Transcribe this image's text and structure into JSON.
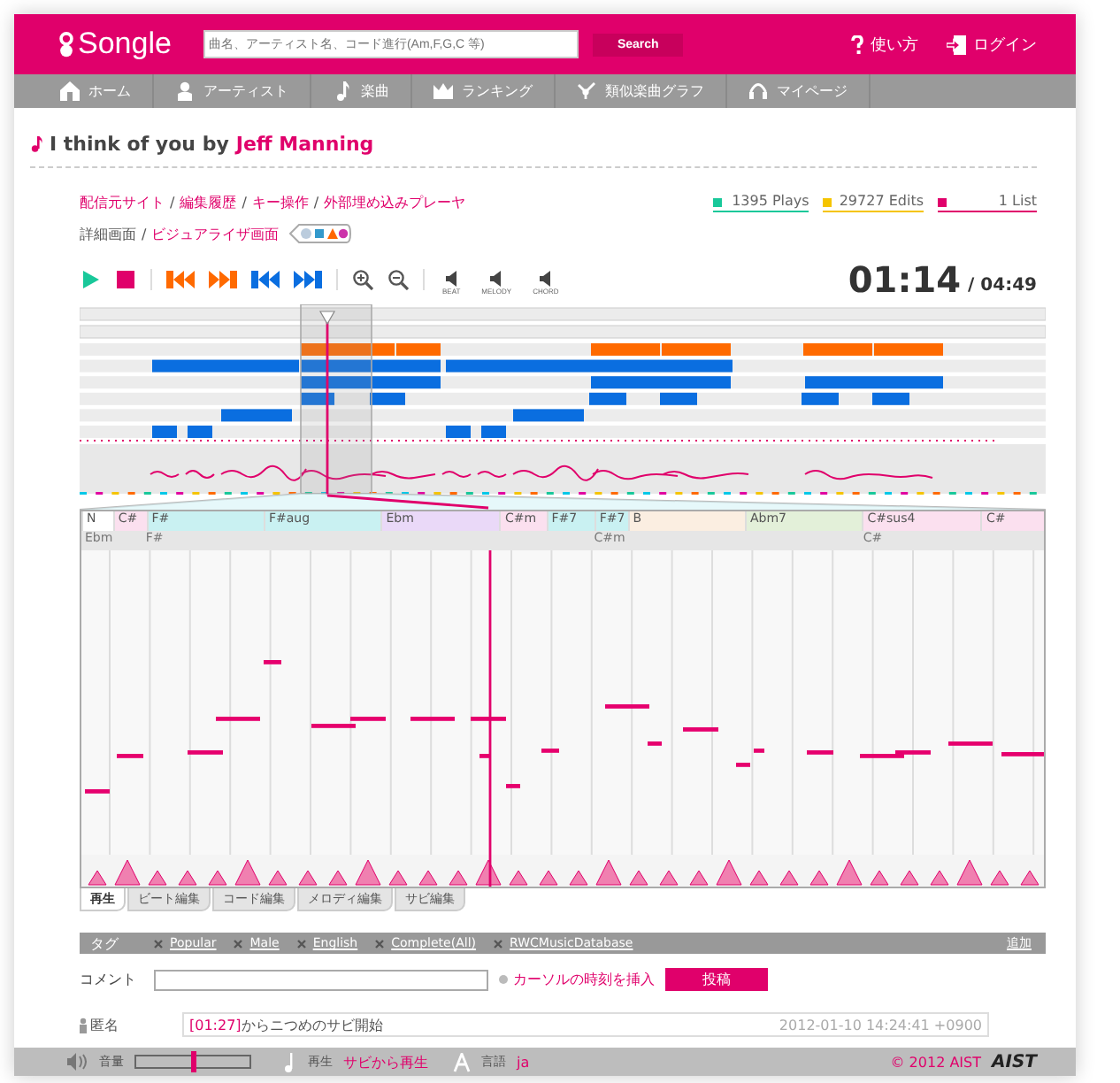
{
  "header": {
    "logo": "Songle",
    "search": {
      "placeholder": "曲名、アーティスト名、コード進行(Am,F,G,C 等)"
    },
    "search_button": "Search",
    "links": [
      {
        "label": "使い方"
      },
      {
        "label": "ログイン"
      }
    ]
  },
  "nav": [
    {
      "label": "ホーム"
    },
    {
      "label": "アーティスト"
    },
    {
      "label": "楽曲"
    },
    {
      "label": "ランキング"
    },
    {
      "label": "類似楽曲グラフ"
    },
    {
      "label": "マイページ"
    }
  ],
  "link_separator": "/",
  "song": {
    "title": "I think of you",
    "by": "by",
    "artist": "Jeff Manning"
  },
  "links_row": [
    "配信元サイト",
    "編集履歴",
    "キー操作",
    "外部埋め込みプレーヤ"
  ],
  "view_links": [
    {
      "label": "詳細画面",
      "selected": true
    },
    {
      "label": "ビジュアライザ画面",
      "selected": false
    }
  ],
  "stats": [
    {
      "label": "1395 Plays",
      "color": "#19c89a"
    },
    {
      "label": "29727 Edits",
      "color": "#f5c400"
    },
    {
      "label": "1 List",
      "color": "#e0006b"
    }
  ],
  "controls": [
    {
      "kind": "play"
    },
    {
      "kind": "stop"
    },
    {
      "kind": "sep"
    },
    {
      "kind": "prev_chorus"
    },
    {
      "kind": "next_chorus"
    },
    {
      "kind": "prev_section"
    },
    {
      "kind": "next_section"
    },
    {
      "kind": "sep"
    },
    {
      "kind": "zoom_in"
    },
    {
      "kind": "zoom_out"
    },
    {
      "kind": "sep"
    }
  ],
  "toggles": [
    {
      "label": "BEAT"
    },
    {
      "label": "MELODY"
    },
    {
      "label": "CHORD"
    }
  ],
  "time": {
    "current": "01:14",
    "total": "/ 04:49"
  },
  "chords": [
    {
      "label": "N",
      "color": "#ffffff"
    },
    {
      "label": "C#",
      "color": "#fbe0ef"
    },
    {
      "label": "F#",
      "color": "#c9f1f2"
    },
    {
      "label": "F#aug",
      "color": "#c9f1f2"
    },
    {
      "label": "Ebm",
      "color": "#ead9f8"
    },
    {
      "label": "C#m",
      "color": "#fbe0ef"
    },
    {
      "label": "F#7",
      "color": "#c9f1f2"
    },
    {
      "label": "F#7",
      "color": "#c9f1f2"
    },
    {
      "label": "B",
      "color": "#fbeee1"
    },
    {
      "label": "Abm7",
      "color": "#e3f0d9"
    },
    {
      "label": "C#sus4",
      "color": "#fbe0ef"
    },
    {
      "label": "C#",
      "color": "#fbe0ef"
    }
  ],
  "chords_secondary": [
    "Ebm",
    "F#",
    "C#m",
    "C#"
  ],
  "edit_tabs": [
    {
      "label": "再生",
      "selected": true
    },
    {
      "label": "ビート編集",
      "selected": false
    },
    {
      "label": "コード編集",
      "selected": false
    },
    {
      "label": "メロディ編集",
      "selected": false
    },
    {
      "label": "サビ編集",
      "selected": false
    }
  ],
  "tags": {
    "label": "タグ",
    "items": [
      "Popular",
      "Male",
      "English",
      "Complete(All)",
      "RWCMusicDatabase"
    ],
    "add": "追加"
  },
  "comment_form": {
    "label": "コメント",
    "insert_time": "カーソルの時刻を挿入",
    "submit": "投稿"
  },
  "comments": [
    {
      "author": "匿名",
      "time": "[01:27]",
      "text": "からニつめのサビ開始",
      "date": "2012-01-10 14:24:41 +0900"
    }
  ],
  "footer": {
    "volume_label": "音量",
    "volume": {
      "level": 0.48
    },
    "play_label": "再生",
    "play_mode": "サビから再生",
    "language_label": "言語",
    "language": "ja",
    "copyright": "© 2012 AIST",
    "logo": "AIST"
  }
}
